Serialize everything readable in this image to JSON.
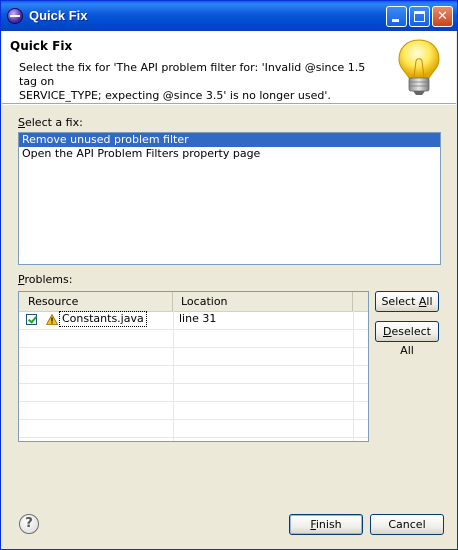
{
  "window": {
    "title": "Quick Fix"
  },
  "header": {
    "title": "Quick Fix",
    "description_line1": "Select the fix for 'The API problem filter for: 'Invalid @since 1.5 tag on",
    "description_line2": "SERVICE_TYPE; expecting @since 3.5' is no longer used'."
  },
  "fixes": {
    "label_prefix": "",
    "label_mnemonic": "S",
    "label_rest": "elect a fix:",
    "items": [
      "Remove unused problem filter",
      "Open the API Problem Filters property page"
    ],
    "selected_index": 0
  },
  "problems": {
    "label_mnemonic": "P",
    "label_rest": "roblems:",
    "columns": [
      "Resource",
      "Location"
    ],
    "rows": [
      {
        "resource": "Constants.java",
        "location": "line 31",
        "checked": true,
        "icon": "warning-icon"
      }
    ],
    "select_all_prefix": "Select ",
    "select_all_mnemonic": "A",
    "select_all_rest": "ll",
    "deselect_all_mnemonic": "D",
    "deselect_all_rest": "eselect All"
  },
  "footer": {
    "finish_mnemonic": "F",
    "finish_rest": "inish",
    "cancel_label": "Cancel",
    "help_glyph": "?"
  },
  "colors": {
    "selection": "#316ac5",
    "titlebar": "#0a57d9",
    "dialog_bg": "#ece9d8"
  }
}
